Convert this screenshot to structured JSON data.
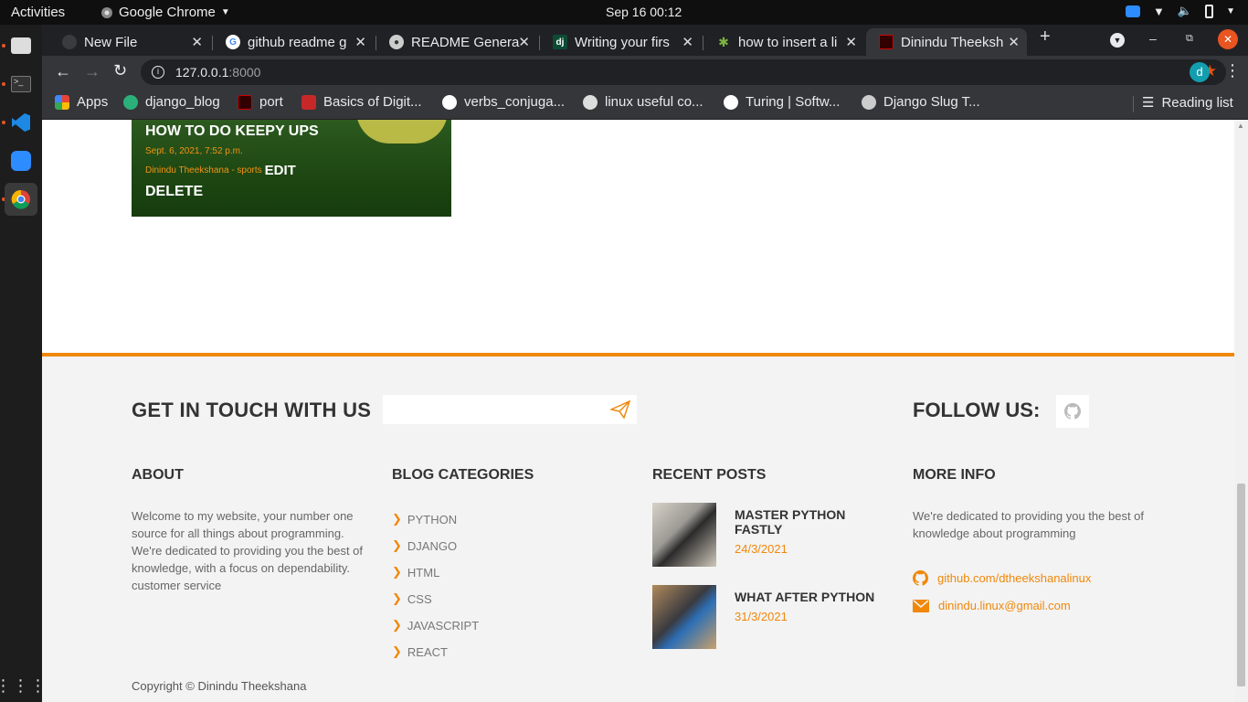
{
  "system": {
    "activities": "Activities",
    "app_name": "Google Chrome",
    "clock": "Sep 16  00:12"
  },
  "tabs": [
    {
      "title": "New File",
      "icon": "file-icon"
    },
    {
      "title": "github readme g",
      "icon": "google-icon"
    },
    {
      "title": "README Genera",
      "icon": "globe-icon"
    },
    {
      "title": "Writing your firs",
      "icon": "django-icon"
    },
    {
      "title": "how to insert a li",
      "icon": "star-icon"
    },
    {
      "title": "Dinindu Theeksh",
      "icon": "site-icon",
      "active": true
    }
  ],
  "omnibox": {
    "host": "127.0.0.1",
    "port": ":8000",
    "profile_initial": "d"
  },
  "bookmarks": [
    {
      "label": "Apps",
      "icon": "apps-grid-icon"
    },
    {
      "label": "django_blog",
      "icon": "puzzle-icon"
    },
    {
      "label": "port",
      "icon": "port-icon"
    },
    {
      "label": "Basics of Digit...",
      "icon": "iit-icon"
    },
    {
      "label": "verbs_conjuga...",
      "icon": "verbs-icon"
    },
    {
      "label": "linux useful co...",
      "icon": "linux-icon"
    },
    {
      "label": "Turing | Softw...",
      "icon": "turing-icon"
    },
    {
      "label": "Django Slug T...",
      "icon": "globe-icon"
    }
  ],
  "reading_list": "Reading list",
  "post": {
    "title": "HOW TO DO KEEPY UPS",
    "date": "Sept. 6, 2021, 7:52 p.m.",
    "meta": "Dinindu Theekshana - sports",
    "edit": "EDIT",
    "delete": "DELETE"
  },
  "footer": {
    "touch_heading": "GET IN TOUCH WITH US",
    "follow_heading": "FOLLOW US:",
    "about": {
      "heading": "ABOUT",
      "text": "Welcome to my website, your number one source for all things about programming. We're dedicated to providing you the best of knowledge, with a focus on dependability. customer service"
    },
    "categories": {
      "heading": "BLOG CATEGORIES",
      "items": [
        "PYTHON",
        "DJANGO",
        "HTML",
        "CSS",
        "JAVASCRIPT",
        "REACT"
      ]
    },
    "recent": {
      "heading": "RECENT POSTS",
      "items": [
        {
          "title": "MASTER PYTHON FASTLY",
          "date": "24/3/2021"
        },
        {
          "title": "WHAT AFTER PYTHON",
          "date": "31/3/2021"
        }
      ]
    },
    "more": {
      "heading": "MORE INFO",
      "text": "We're dedicated to providing you the best of knowledge about programming",
      "github": "github.com/dtheekshanalinux",
      "email": "dinindu.linux@gmail.com"
    },
    "copyright": "Copyright © Dinindu Theekshana"
  },
  "colors": {
    "accent": "#f0880a",
    "chrome_dark": "#202124",
    "chrome_toolbar": "#35363a"
  }
}
